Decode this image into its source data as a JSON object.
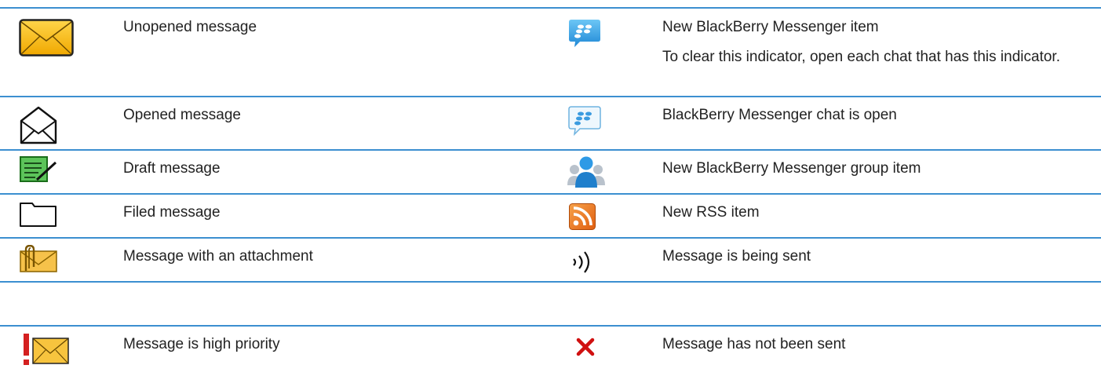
{
  "left": [
    {
      "icon": "unopened-envelope-icon",
      "label": "Unopened message"
    },
    {
      "icon": "opened-envelope-icon",
      "label": "Opened message"
    },
    {
      "icon": "draft-icon",
      "label": "Draft message"
    },
    {
      "icon": "folder-icon",
      "label": "Filed message"
    },
    {
      "icon": "attachment-envelope-icon",
      "label": "Message with an attachment"
    },
    {
      "icon": "high-priority-envelope-icon",
      "label": "Message is high priority"
    }
  ],
  "right": [
    {
      "icon": "bbm-new-item-icon",
      "label": "New BlackBerry Messenger item",
      "note": "To clear this indicator, open each chat that has this indicator."
    },
    {
      "icon": "bbm-chat-open-icon",
      "label": "BlackBerry Messenger chat is open"
    },
    {
      "icon": "bbm-group-icon",
      "label": "New BlackBerry Messenger group item"
    },
    {
      "icon": "rss-icon",
      "label": "New RSS item"
    },
    {
      "icon": "sending-icon",
      "label": "Message is being sent"
    },
    {
      "icon": "not-sent-x-icon",
      "label": "Message has not been sent"
    }
  ],
  "colors": {
    "rule": "#3c8fd0",
    "envelope_yellow": "#f7b900",
    "error_red": "#d01010"
  }
}
